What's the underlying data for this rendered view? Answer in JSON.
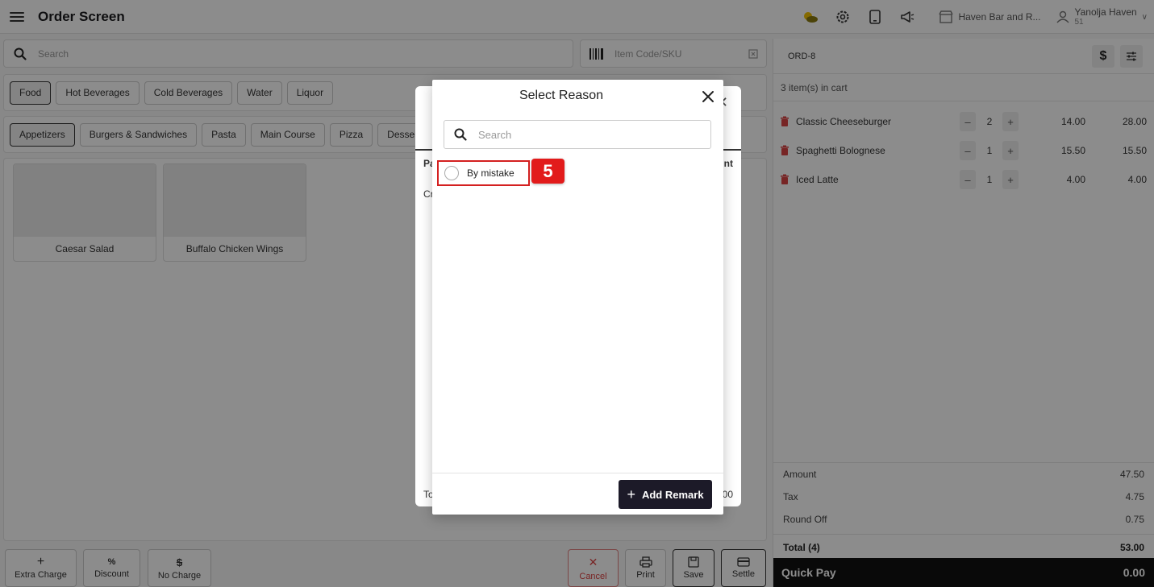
{
  "header": {
    "title": "Order Screen",
    "store": "Haven Bar and R...",
    "user_name": "Yanolja Haven",
    "user_sub": "51"
  },
  "search": {
    "placeholder": "Search"
  },
  "sku": {
    "placeholder": "Item Code/SKU"
  },
  "categories": [
    "Food",
    "Hot Beverages",
    "Cold Beverages",
    "Water",
    "Liquor"
  ],
  "subcategories": [
    "Appetizers",
    "Burgers & Sandwiches",
    "Pasta",
    "Main Course",
    "Pizza",
    "Desserts"
  ],
  "products": [
    "Caesar Salad",
    "Buffalo Chicken Wings"
  ],
  "bottom_actions": {
    "extra_charge": "Extra Charge",
    "discount": "Discount",
    "no_charge": "No Charge",
    "cancel": "Cancel",
    "print": "Print",
    "save": "Save",
    "settle": "Settle"
  },
  "cart": {
    "order_id": "ORD-8",
    "count_text": "3 item(s) in cart",
    "items": [
      {
        "name": "Classic Cheeseburger",
        "qty": "2",
        "price": "14.00",
        "total": "28.00"
      },
      {
        "name": "Spaghetti Bolognese",
        "qty": "1",
        "price": "15.50",
        "total": "15.50"
      },
      {
        "name": "Iced Latte",
        "qty": "1",
        "price": "4.00",
        "total": "4.00"
      }
    ],
    "summary": {
      "amount_label": "Amount",
      "amount": "47.50",
      "tax_label": "Tax",
      "tax": "4.75",
      "round_label": "Round Off",
      "round": "0.75",
      "total_label": "Total (4)",
      "total": "53.00"
    },
    "quick_pay_label": "Quick Pay",
    "quick_pay_amount": "0.00"
  },
  "back_modal": {
    "col_left": "Pa",
    "col_right": "nt",
    "row_left": "Cr",
    "foot_left": "To",
    "foot_right": "00"
  },
  "modal": {
    "title": "Select Reason",
    "search_placeholder": "Search",
    "options": [
      "By mistake"
    ],
    "step_badge": "5",
    "add_remark_label": "Add Remark"
  }
}
